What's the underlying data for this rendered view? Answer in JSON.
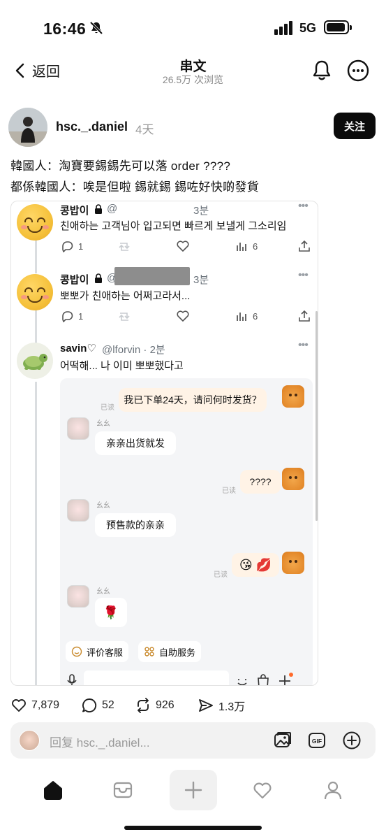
{
  "status_bar": {
    "time": "16:46",
    "network": "5G",
    "icons": [
      "bell-off-icon",
      "signal-icon",
      "battery-icon"
    ]
  },
  "nav": {
    "back_label": "返回",
    "title": "串文",
    "views": "26.5万 次浏览"
  },
  "post": {
    "username": "hsc._.daniel",
    "age": "4天",
    "follow_label": "关注",
    "lines": [
      "韓國人：淘寶要錫錫先可以落 order ????",
      "都係韓國人：唉是但啦 錫就錫 錫咗好快啲發貨"
    ]
  },
  "embed": {
    "tweets": [
      {
        "name": "콩밥이",
        "handle_prefix": "@",
        "time": "3분",
        "text": "친애하는 고객님아 입고되면 빠르게 보낼게 그소리임",
        "replies": "1",
        "views": "6"
      },
      {
        "name": "콩밥이",
        "handle_prefix": "@",
        "time": "3분",
        "text": "뽀뽀가 친애하는 어쩌고라서...",
        "replies": "1",
        "views": "6"
      },
      {
        "name": "savin♡",
        "handle": "@lforvin · 2분",
        "text": "어떡해... 나 이미 뽀뽀했다고"
      }
    ],
    "chat": {
      "read_label": "已读",
      "agent_name": "幺幺",
      "msg_order": "我已下单24天，请问何时发货？",
      "msg_reply1": "亲亲出货就发",
      "msg_q": "????",
      "msg_reply2": "预售款的亲亲",
      "msg_kiss": "😘 💋",
      "msg_rose": "🌹",
      "btn_rate": "评价客服",
      "btn_self": "自助服务"
    }
  },
  "actions": {
    "likes": "7,879",
    "comments": "52",
    "reposts": "926",
    "shares": "1.3万"
  },
  "reply": {
    "placeholder": "回复 hsc._.daniel..."
  },
  "colors": {
    "accent_dark": "#0b0b0b",
    "muted_text": "#8a8a8a",
    "reply_bg": "#f2f2f2"
  }
}
